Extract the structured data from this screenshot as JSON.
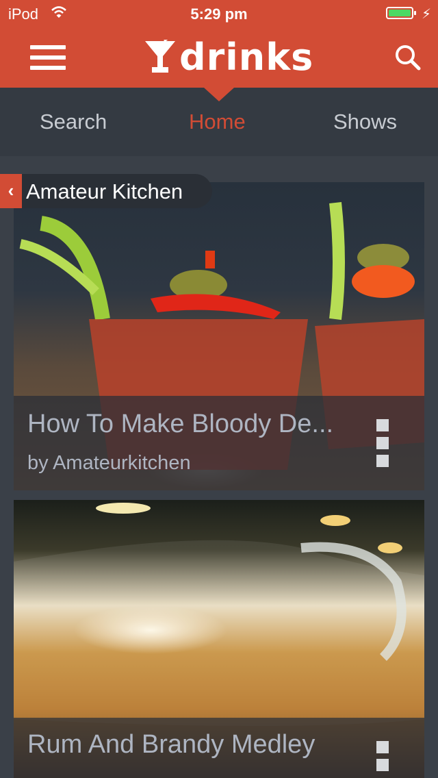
{
  "status_bar": {
    "carrier": "iPod",
    "time": "5:29 pm",
    "battery_level": 1.0
  },
  "header": {
    "logo_text": "drinks",
    "menu_icon": "hamburger-menu-icon",
    "search_icon": "search-icon"
  },
  "tabs": [
    {
      "label": "Search",
      "active": false
    },
    {
      "label": "Home",
      "active": true
    },
    {
      "label": "Shows",
      "active": false
    }
  ],
  "category": {
    "label": "Amateur Kitchen",
    "back_glyph": "‹"
  },
  "cards": [
    {
      "title": "How To Make Bloody De...",
      "byline": "by Amateurkitchen"
    },
    {
      "title": "Rum And Brandy Medley"
    }
  ],
  "colors": {
    "accent": "#d24c35",
    "tabbar": "#343a42",
    "background": "#3a4048"
  }
}
